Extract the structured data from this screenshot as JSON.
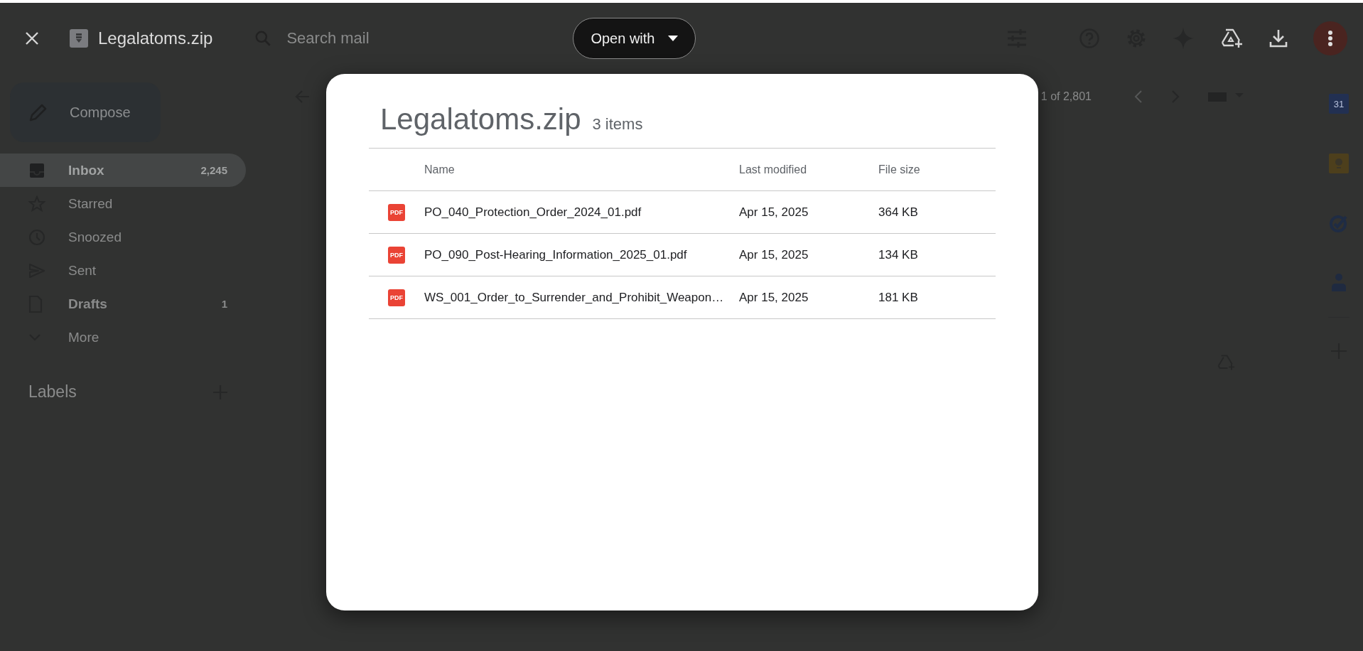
{
  "viewer_bar": {
    "file_title": "Legalatoms.zip",
    "open_with": "Open with"
  },
  "gmail": {
    "search": {
      "placeholder": "Search mail"
    },
    "compose": "Compose",
    "folders": [
      {
        "kind": "inbox",
        "label": "Inbox",
        "count": "2,245",
        "selected": true,
        "unread": true
      },
      {
        "kind": "starred",
        "label": "Starred",
        "selected": false,
        "unread": false
      },
      {
        "kind": "snoozed",
        "label": "Snoozed",
        "selected": false,
        "unread": false
      },
      {
        "kind": "sent",
        "label": "Sent",
        "selected": false,
        "unread": false
      },
      {
        "kind": "drafts",
        "label": "Drafts",
        "count": "1",
        "selected": false,
        "unread": true
      },
      {
        "kind": "more",
        "label": "More",
        "selected": false,
        "unread": false
      }
    ],
    "labels_heading": "Labels",
    "pager": "1 of 2,801",
    "calendar_day": "31"
  },
  "archive": {
    "title": "Legalatoms.zip",
    "count": "3 items",
    "columns": [
      "Name",
      "Last modified",
      "File size"
    ],
    "rows": [
      {
        "badge": "PDF",
        "name": "PO_040_Protection_Order_2024_01.pdf",
        "modified": "Apr 15, 2025",
        "size": "364 KB"
      },
      {
        "badge": "PDF",
        "name": "PO_090_Post-Hearing_Information_2025_01.pdf",
        "modified": "Apr 15, 2025",
        "size": "134 KB"
      },
      {
        "badge": "PDF",
        "name": "WS_001_Order_to_Surrender_and_Prohibit_Weapon…",
        "modified": "Apr 15, 2025",
        "size": "181 KB"
      }
    ]
  }
}
